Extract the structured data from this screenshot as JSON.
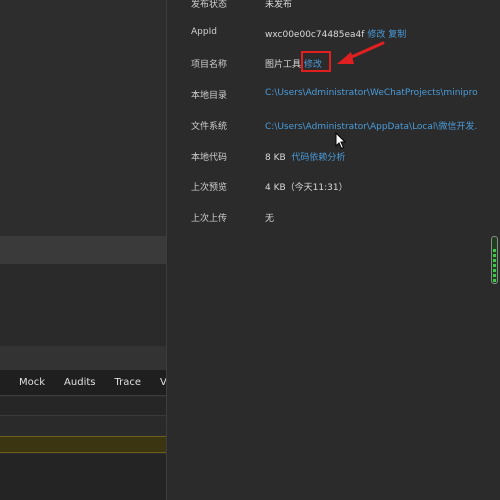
{
  "devtools": {
    "tabs": [
      "Mock",
      "Audits",
      "Trace",
      "Vu"
    ]
  },
  "project_info": {
    "status": {
      "label": "发布状态",
      "value": "未发布"
    },
    "appid": {
      "label": "AppId",
      "value": "wxc00e00c74485ea4f",
      "edit_link": "修改",
      "copy_link": "复制"
    },
    "name": {
      "label": "项目名称",
      "value": "图片工具",
      "edit_link": "修改"
    },
    "local_dir": {
      "label": "本地目录",
      "value": "C:\\Users\\Administrator\\WeChatProjects\\miniprogr..."
    },
    "file_system": {
      "label": "文件系统",
      "value": "C:\\Users\\Administrator\\AppData\\Local\\微信开发..."
    },
    "local_code": {
      "label": "本地代码",
      "value": "8 KB",
      "link": "代码依赖分析"
    },
    "last_preview": {
      "label": "上次预览",
      "value": "4 KB（今天11:31）"
    },
    "last_upload": {
      "label": "上次上传",
      "value": "无"
    }
  },
  "colors": {
    "link": "#4a9bd9",
    "highlight": "#e02020",
    "warning_row": "#3b3512"
  },
  "indicator": {
    "level": 0.75
  }
}
